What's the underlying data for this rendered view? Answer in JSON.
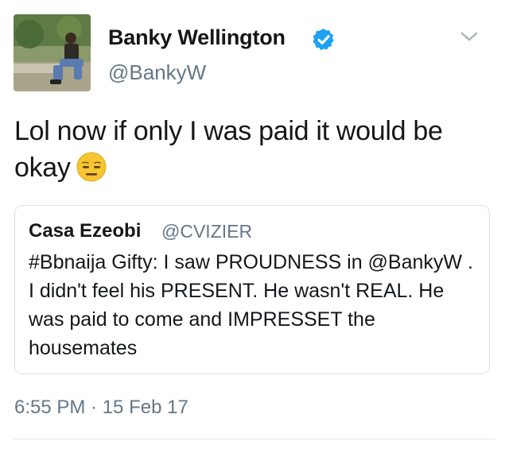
{
  "author": {
    "display_name": "Banky Wellington",
    "handle": "@BankyW",
    "verified": true
  },
  "tweet": {
    "text": "Lol now if only I was paid it would be okay",
    "emoji": "expressionless-face-emoji"
  },
  "quoted_tweet": {
    "display_name": "Casa Ezeobi",
    "handle": "@CVIZIER",
    "text": "#Bbnaija Gifty: I saw PROUDNESS in @BankyW . I didn't feel his PRESENT. He wasn't REAL. He was paid to come and IMPRESSET the housemates"
  },
  "timestamp": "6:55 PM · 15 Feb 17",
  "colors": {
    "text_primary": "#14171a",
    "text_secondary": "#657786",
    "verified_blue": "#1da1f2",
    "border": "#dcdfe2"
  },
  "icons": {
    "verified": "verified-badge-icon",
    "menu": "chevron-down-icon",
    "emoji": "expressionless-face-emoji"
  }
}
